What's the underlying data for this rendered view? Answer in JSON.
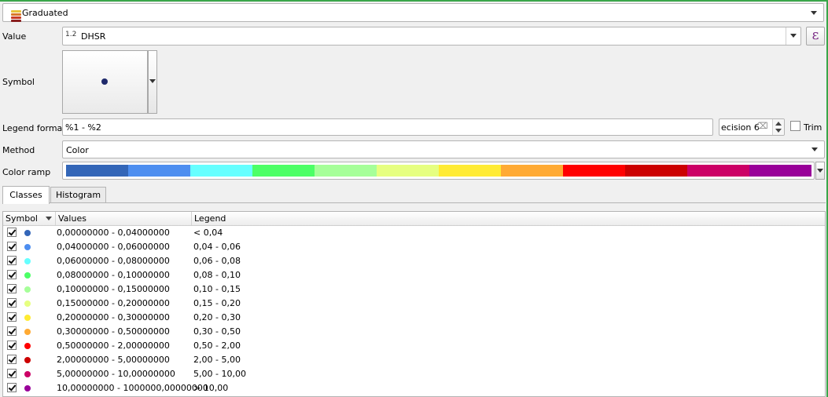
{
  "renderer": {
    "label": "Graduated"
  },
  "value": {
    "label": "Value",
    "type_badge": "1.2",
    "field": "DHSR"
  },
  "symbol": {
    "label": "Symbol",
    "color": "#1f2a6b"
  },
  "legend_format": {
    "label": "Legend format",
    "value": "%1 - %2",
    "precision_text": "ecision 6",
    "trim_label": "Trim"
  },
  "method": {
    "label": "Method",
    "value": "Color"
  },
  "color_ramp": {
    "label": "Color ramp",
    "colors": [
      "#3366b8",
      "#4d8ef0",
      "#66ffff",
      "#4cff66",
      "#a6ff99",
      "#e6ff80",
      "#ffeb33",
      "#ffaa33",
      "#ff0000",
      "#cc0000",
      "#cc0066",
      "#990099"
    ]
  },
  "tabs": [
    {
      "label": "Classes"
    },
    {
      "label": "Histogram"
    }
  ],
  "table": {
    "headers": [
      "Symbol",
      "Values",
      "Legend"
    ],
    "rows": [
      {
        "color": "#3366b8",
        "values": "0,00000000 - 0,04000000",
        "legend": "< 0,04"
      },
      {
        "color": "#4d8ef0",
        "values": "0,04000000 - 0,06000000",
        "legend": "0,04 - 0,06"
      },
      {
        "color": "#66ffff",
        "values": "0,06000000 - 0,08000000",
        "legend": "0,06 - 0,08"
      },
      {
        "color": "#4cff66",
        "values": "0,08000000 - 0,10000000",
        "legend": "0,08 - 0,10"
      },
      {
        "color": "#a6ff99",
        "values": "0,10000000 - 0,15000000",
        "legend": "0,10 - 0,15"
      },
      {
        "color": "#e6ff80",
        "values": "0,15000000 - 0,20000000",
        "legend": "0,15 - 0,20"
      },
      {
        "color": "#ffeb33",
        "values": "0,20000000 - 0,30000000",
        "legend": "0,20 - 0,30"
      },
      {
        "color": "#ffaa33",
        "values": "0,30000000 - 0,50000000",
        "legend": "0,30 - 0,50"
      },
      {
        "color": "#ff0000",
        "values": "0,50000000 - 2,00000000",
        "legend": "0,50 - 2,00"
      },
      {
        "color": "#cc0000",
        "values": "2,00000000 - 5,00000000",
        "legend": "2,00 - 5,00"
      },
      {
        "color": "#cc0066",
        "values": "5,00000000 - 10,00000000",
        "legend": "5,00 - 10,00"
      },
      {
        "color": "#990099",
        "values": "10,00000000 - 1000000,00000000",
        "legend": "> 10,00"
      }
    ]
  },
  "icons": {
    "expression": "ε",
    "clear": "⌫"
  }
}
